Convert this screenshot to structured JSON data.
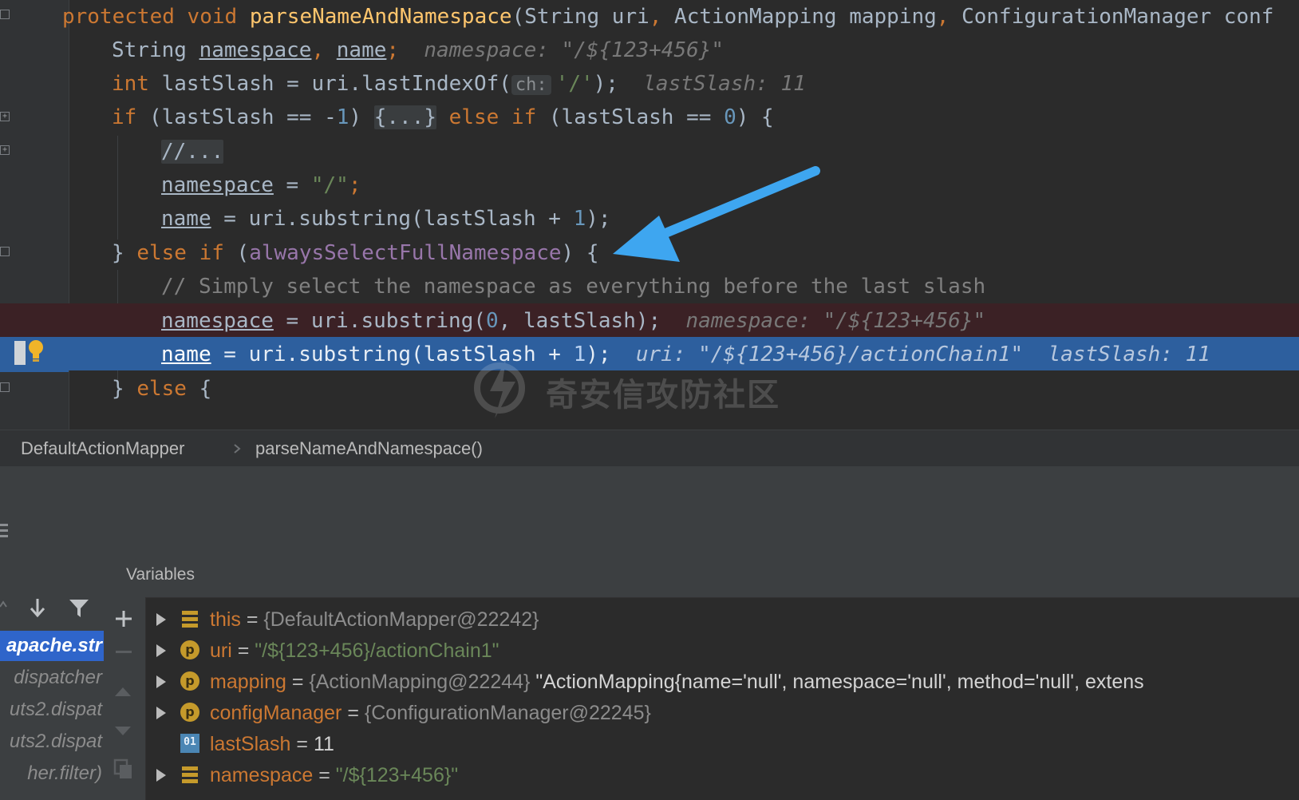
{
  "editor": {
    "lines": {
      "l0": {
        "kw1": "protected",
        "kw2": "void",
        "fn": "parseNameAndNamespace",
        "p1": "(String uri",
        "c1": ",",
        "p2": " ActionMapping mapping",
        "c2": ",",
        "p3": " ConfigurationManager conf"
      },
      "l1": {
        "t1": "String ",
        "v1": "namespace",
        "c1": ",",
        "v2": "name",
        "semi": ";",
        "hint": "namespace: \"/${123+456}\""
      },
      "l2": {
        "kw": "int",
        "t1": " lastSlash = uri.lastIndexOf(",
        "param": "ch:",
        "str": "'/'",
        "t2": ");",
        "hint": "lastSlash: 11"
      },
      "l3": {
        "kw1": "if",
        "t1": " (lastSlash == -",
        "n1": "1",
        "t2": ") ",
        "fold": "{...}",
        "kw2": "else if",
        "t3": " (lastSlash == ",
        "n2": "0",
        "t4": ") {"
      },
      "l4": {
        "cmt": "//..."
      },
      "l5": {
        "v": "namespace",
        "t1": " = ",
        "str": "\"/\"",
        "semi": ";"
      },
      "l6": {
        "v": "name",
        "t1": " = uri.substring(lastSlash + ",
        "n": "1",
        "t2": ");"
      },
      "l7": {
        "t1": "} ",
        "kw": "else if",
        "t2": " (",
        "fld": "alwaysSelectFullNamespace",
        "t3": ") {"
      },
      "l8": {
        "cmt": "// Simply select the namespace as everything before the last slash"
      },
      "l9": {
        "v": "namespace",
        "t1": " = uri.substring(",
        "n": "0",
        "t2": ", lastSlash);",
        "hint": "namespace: \"/${123+456}\""
      },
      "l10": {
        "v": "name",
        "t1": " = uri.substring(lastSlash + ",
        "n": "1",
        "t2": ");",
        "hint1": "uri: \"/${123+456}/actionChain1\"",
        "hint2": "lastSlash: 11"
      },
      "l11": {
        "t1": "} ",
        "kw": "else",
        "t2": " {"
      }
    }
  },
  "watermark": {
    "text": "奇安信攻防社区"
  },
  "breadcrumb": {
    "class_name": "DefaultActionMapper",
    "method_name": "parseNameAndNamespace()"
  },
  "frames": {
    "items": [
      "apache.str",
      "dispatcher",
      "uts2.dispat",
      "uts2.dispat",
      "her.filter)"
    ]
  },
  "variables": {
    "title": "Variables",
    "rows": [
      {
        "name": "this",
        "eq": " = ",
        "type": "{DefaultActionMapper@22242}",
        "value": "",
        "icon": "field-bars-icon"
      },
      {
        "name": "uri",
        "eq": " = ",
        "type": "",
        "value": "\"/${123+456}/actionChain1\"",
        "icon": "parameter-icon"
      },
      {
        "name": "mapping",
        "eq": " = ",
        "type": "{ActionMapping@22244}",
        "value": " \"ActionMapping{name='null', namespace='null', method='null', extens",
        "icon": "parameter-icon"
      },
      {
        "name": "configManager",
        "eq": " = ",
        "type": "{ConfigurationManager@22245}",
        "value": "",
        "icon": "parameter-icon"
      },
      {
        "name": "lastSlash",
        "eq": " = ",
        "type": "",
        "value": "11",
        "icon": "primitive-icon"
      },
      {
        "name": "namespace",
        "eq": " = ",
        "type": "",
        "value": "\"/${123+456}\"",
        "icon": "field-bars-icon"
      }
    ],
    "param_icon_letter": "p",
    "primitive_icon_text": "01"
  },
  "colors": {
    "editor_bg": "#2b2b2b",
    "keyword": "#cc7832",
    "function": "#ffc66d",
    "string": "#6a8759",
    "number": "#6897bb",
    "field": "#9876aa",
    "breakpoint_line": "#3b2125",
    "execution_line": "#2d5f9e",
    "annotation_arrow": "#3ea6f0",
    "selected_frame": "#2f65ca"
  }
}
